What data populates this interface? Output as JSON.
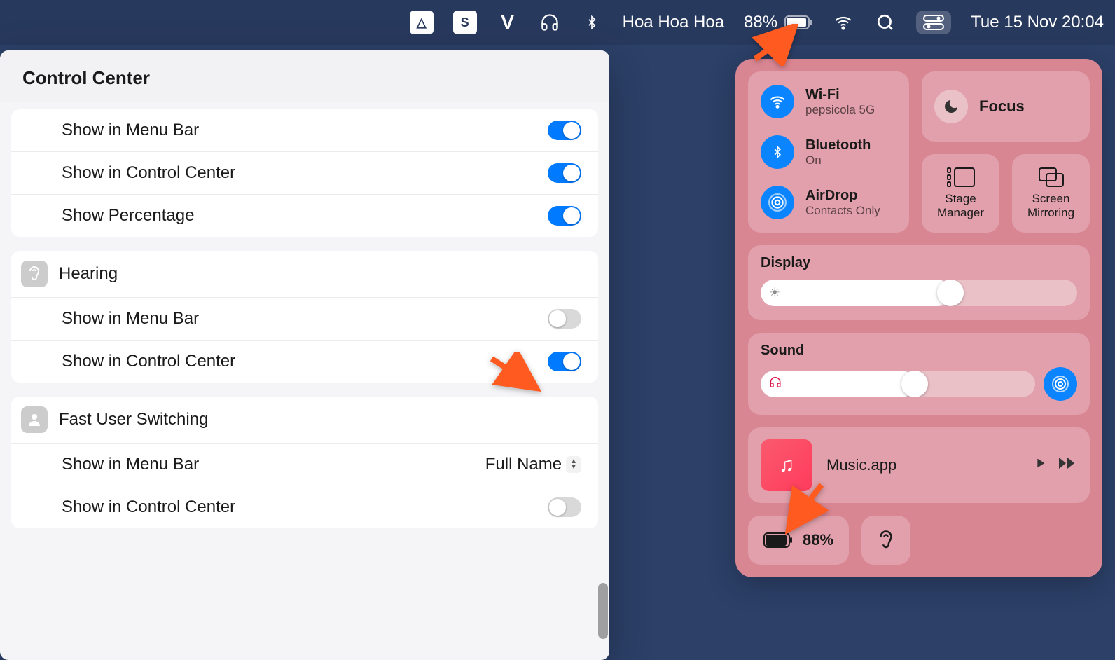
{
  "menubar": {
    "user_label": "Hoa Hoa Hoa",
    "battery_percent": "88%",
    "datetime": "Tue 15 Nov  20:04"
  },
  "settings": {
    "title": "Control Center",
    "top_rows": [
      {
        "label": "Show in Menu Bar",
        "on": true
      },
      {
        "label": "Show in Control Center",
        "on": true
      },
      {
        "label": "Show Percentage",
        "on": true
      }
    ],
    "hearing": {
      "title": "Hearing",
      "rows": [
        {
          "label": "Show in Menu Bar",
          "on": false
        },
        {
          "label": "Show in Control Center",
          "on": true
        }
      ]
    },
    "fast_user": {
      "title": "Fast User Switching",
      "menu_bar_label": "Show in Menu Bar",
      "menu_bar_value": "Full Name",
      "cc_label": "Show in Control Center",
      "cc_on": false
    }
  },
  "cc": {
    "wifi": {
      "title": "Wi-Fi",
      "subtitle": "pepsicola 5G"
    },
    "bluetooth": {
      "title": "Bluetooth",
      "subtitle": "On"
    },
    "airdrop": {
      "title": "AirDrop",
      "subtitle": "Contacts Only"
    },
    "focus": "Focus",
    "stage_manager": "Stage Manager",
    "screen_mirroring": "Screen Mirroring",
    "display": "Display",
    "sound": "Sound",
    "music_app": "Music.app",
    "battery_tile": "88%"
  }
}
